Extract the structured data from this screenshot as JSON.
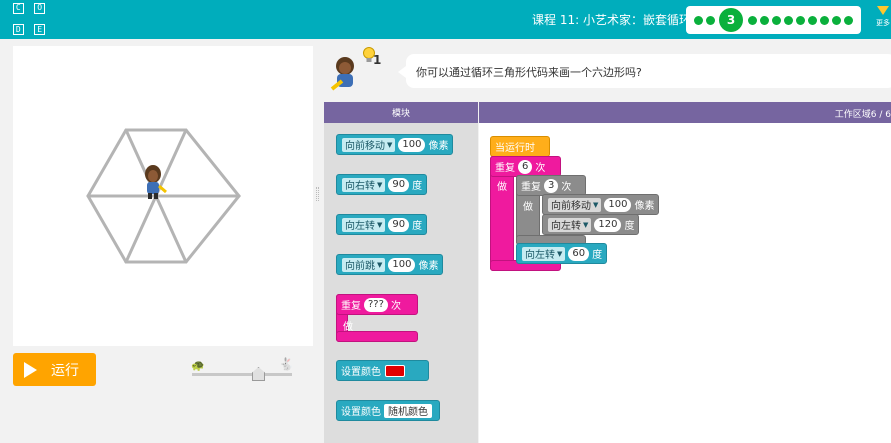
{
  "header": {
    "logo_letters": [
      "C",
      "O",
      "D",
      "E"
    ],
    "lesson_title": "课程 11: 小艺术家：嵌套循环",
    "progress": {
      "current_level": "3",
      "dots_before": 2,
      "dots_after": 10
    },
    "more_label": "更多",
    "brand_color": "#00adbc"
  },
  "stage": {
    "run_label": "运行",
    "speed_slider_value": 0.65
  },
  "instructions": {
    "hint_count": "1",
    "text": "你可以通过循环三角形代码来画一个六边形吗?"
  },
  "toolbox": {
    "header": "模块",
    "blocks": [
      {
        "label": "向前移动",
        "value": "100",
        "unit": "像素"
      },
      {
        "label": "向右转",
        "value": "90",
        "unit": "度"
      },
      {
        "label": "向左转",
        "value": "90",
        "unit": "度"
      },
      {
        "label": "向前跳",
        "value": "100",
        "unit": "像素"
      }
    ],
    "repeat": {
      "label": "重复",
      "value": "???",
      "unit": "次",
      "do": "做"
    },
    "set_color": {
      "label": "设置颜色",
      "color": "#e10000"
    },
    "set_random_color": {
      "label": "设置颜色",
      "value": "随机颜色"
    }
  },
  "workspace": {
    "header": "工作区域6 / 6",
    "when_run": "当运行时",
    "outer_repeat": {
      "label": "重复",
      "value": "6",
      "unit": "次",
      "do": "做"
    },
    "inner_repeat": {
      "label": "重复",
      "value": "3",
      "unit": "次",
      "do": "做"
    },
    "move": {
      "label": "向前移动",
      "value": "100",
      "unit": "像素"
    },
    "turn_inner": {
      "label": "向左转",
      "value": "120",
      "unit": "度"
    },
    "turn_outer": {
      "label": "向左转",
      "value": "60",
      "unit": "度"
    }
  }
}
